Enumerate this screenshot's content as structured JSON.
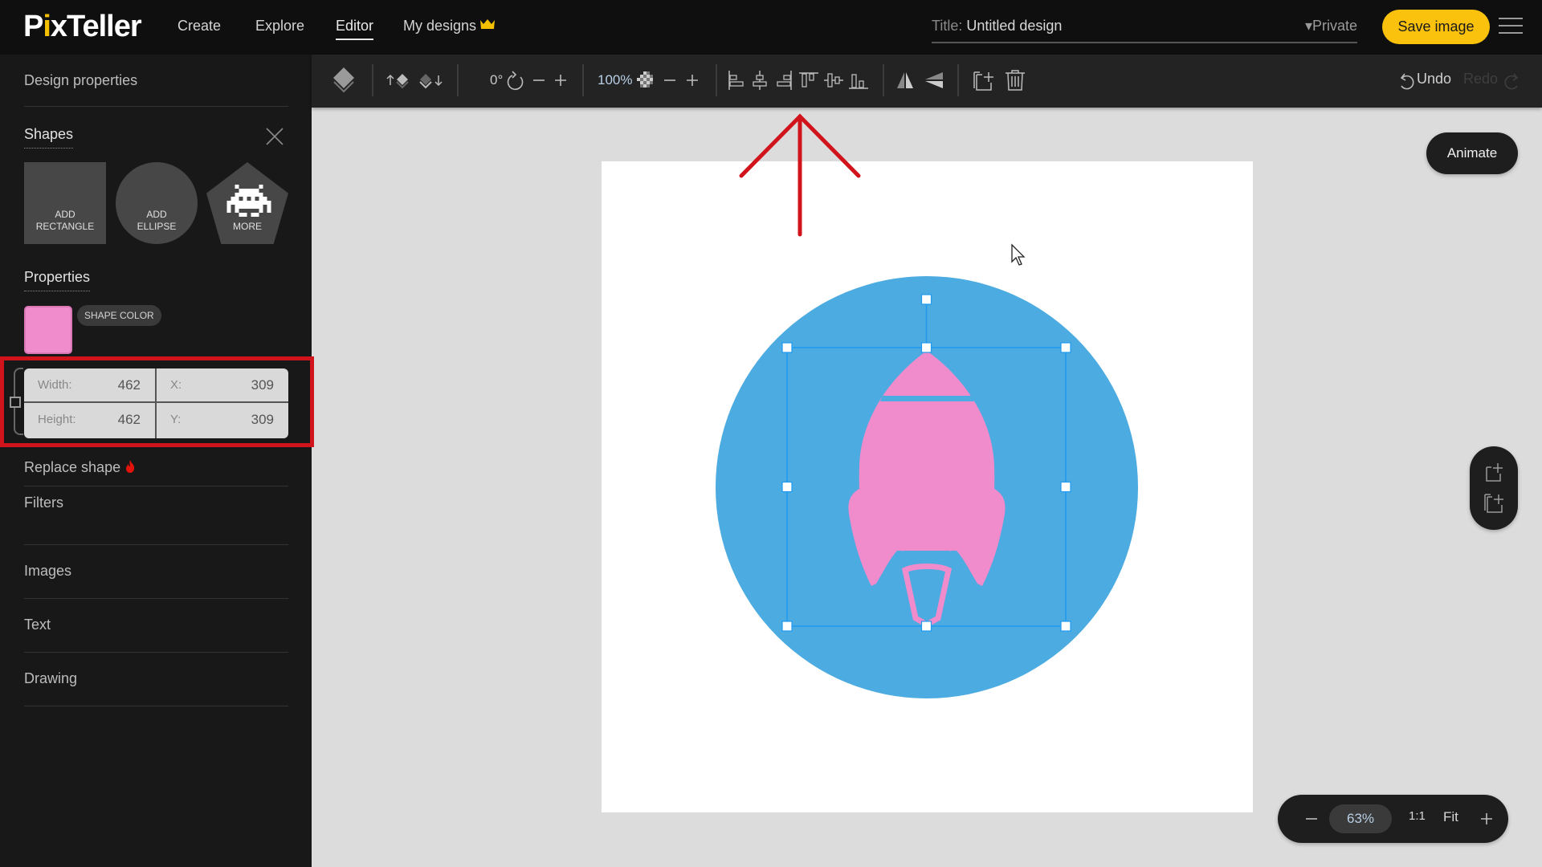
{
  "app": {
    "logo": {
      "left": "P",
      "dot_i": "i",
      "rest": "xTeller"
    },
    "nav": [
      {
        "label": "Create"
      },
      {
        "label": "Explore"
      },
      {
        "label": "Editor",
        "active": true
      },
      {
        "label": "My designs",
        "icon": "crown-icon"
      }
    ],
    "title_label": "Title:",
    "title_value": "Untitled design",
    "privacy": "▾Private",
    "save_label": "Save image",
    "accent_color": "#fbc20d"
  },
  "sidebar": {
    "design_properties": "Design properties",
    "shapes": {
      "heading": "Shapes",
      "add_rectangle": [
        "ADD",
        "RECTANGLE"
      ],
      "add_ellipse": [
        "ADD",
        "ELLIPSE"
      ],
      "more": "MORE"
    },
    "properties": {
      "heading": "Properties",
      "shape_color_label": "SHAPE COLOR",
      "shape_color": "#f08bcc",
      "width_label": "Width:",
      "width_value": "462",
      "height_label": "Height:",
      "height_value": "462",
      "x_label": "X:",
      "x_value": "309",
      "y_label": "Y:",
      "y_value": "309"
    },
    "replace_shape": "Replace shape",
    "filters": "Filters",
    "sections": [
      "Images",
      "Text",
      "Drawing"
    ]
  },
  "toolbar": {
    "rotation": "0°",
    "opacity": "100%",
    "undo": "Undo",
    "redo": "Redo"
  },
  "canvas": {
    "animate_label": "Animate",
    "circle_color": "#4cabe0",
    "rocket_color": "#f08bcc",
    "selection_color": "#1f9af0",
    "annotation_color": "#d1131b"
  },
  "zoom": {
    "value": "63%",
    "one_to_one": "1:1",
    "fit": "Fit"
  }
}
